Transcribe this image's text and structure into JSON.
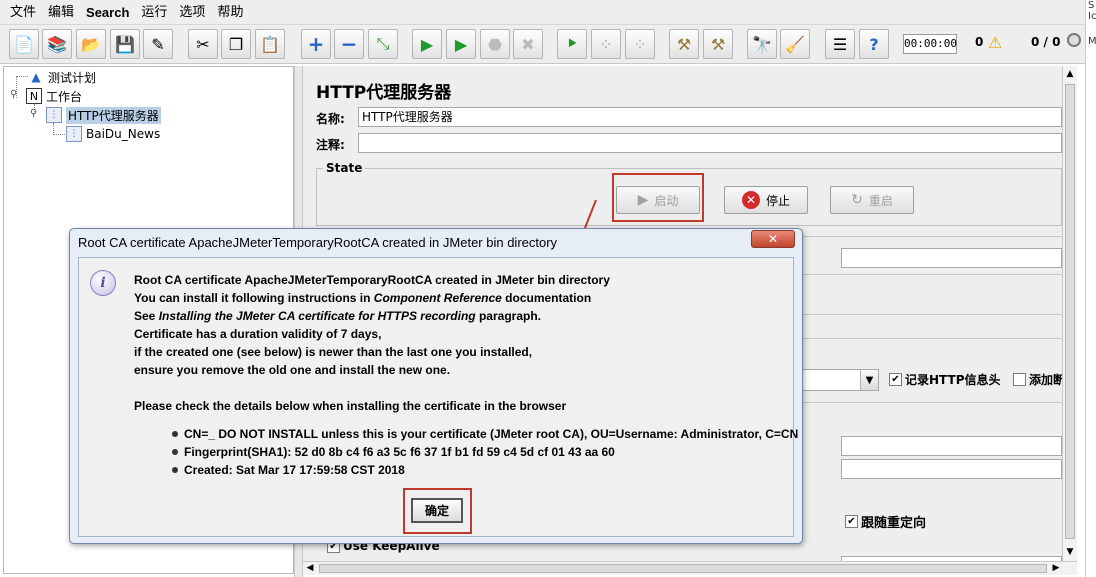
{
  "menu": [
    "文件",
    "编辑",
    "Search",
    "运行",
    "选项",
    "帮助"
  ],
  "toolbar": {
    "timer": "00:00:00",
    "warning_count": "0",
    "thread_ratio": "0 / 0",
    "icons": [
      "new-icon",
      "templates-icon",
      "open-icon",
      "save-icon",
      "save-as-icon",
      "cut-icon",
      "copy-icon",
      "paste-icon",
      "expand-icon",
      "collapse-icon",
      "toggle-icon",
      "start-icon",
      "start-no-pause-icon",
      "stop-icon",
      "shutdown-icon",
      "remote-start-icon",
      "remote-stop-icon",
      "remote-shutdown-icon",
      "clear-icon",
      "clear-all-icon",
      "search-icon",
      "reset-search-icon",
      "function-helper-icon",
      "help-icon"
    ]
  },
  "edge_text": [
    "S",
    "Ic",
    "M"
  ],
  "tree": {
    "nodes": [
      {
        "label": "测试计划"
      },
      {
        "label": "工作台"
      },
      {
        "label": "HTTP代理服务器"
      },
      {
        "label": "BaiDu_News"
      }
    ]
  },
  "panel": {
    "title": "HTTP代理服务器",
    "name_label": "名称:",
    "name_value": "HTTP代理服务器",
    "comment_label": "注释:",
    "comment_value": "",
    "state_label": "State",
    "start_label": "启动",
    "stop_label": "停止",
    "restart_label": "重启",
    "record_headers_label": "记录HTTP信息头",
    "add_assertion_label": "添加断",
    "follow_redirects_label": "跟随重定向",
    "keepalive_label": "Use KeepAlive"
  },
  "dialog": {
    "title": "Root CA certificate ApacheJMeterTemporaryRootCA created in JMeter bin directory",
    "line1": "Root CA certificate ApacheJMeterTemporaryRootCA created in JMeter bin directory",
    "line2_pre": "You can install it following instructions in ",
    "line2_em": "Component Reference",
    "line2_post": " documentation",
    "line3_pre": "See ",
    "line3_em": "Installing the JMeter CA certificate for HTTPS recording",
    "line3_post": " paragraph.",
    "line4": "Certificate has a duration validity of 7 days,",
    "line5": "if the created one (see below) is newer than the last one you installed,",
    "line6": "ensure you remove the old one and install the new one.",
    "line7": "Please check the details below when installing the certificate in the browser",
    "bullets": [
      "CN=_ DO NOT INSTALL unless this is your certificate (JMeter root CA), OU=Username: Administrator, C=CN",
      "Fingerprint(SHA1): 52 d0 8b c4 f6 a3 5c f6 37 1f b1 fd 59 c4 5d cf 01 43 aa 60",
      "Created: Sat Mar 17 17:59:58 CST 2018"
    ],
    "ok_label": "确定"
  },
  "colors": {
    "annotation_red": "#c0392b",
    "selection_blue": "#b8cfe5",
    "stop_red": "#d62b2b"
  }
}
